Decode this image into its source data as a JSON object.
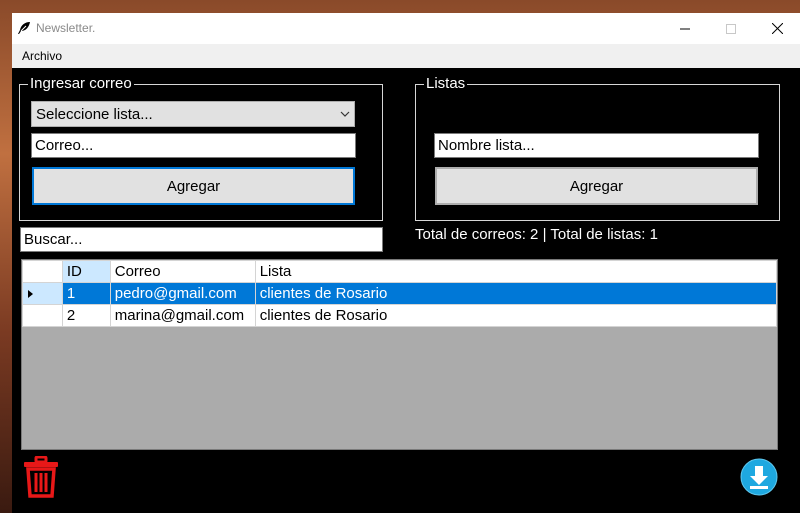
{
  "window": {
    "title": "Newsletter.",
    "icon": "feather-icon"
  },
  "menu": {
    "items": [
      {
        "label": "Archivo"
      }
    ]
  },
  "ingresar": {
    "legend": "Ingresar correo",
    "list_select_value": "Seleccione lista...",
    "email_value": "Correo...",
    "add_label": "Agregar"
  },
  "listas": {
    "legend": "Listas",
    "name_value": "Nombre lista...",
    "add_label": "Agregar"
  },
  "search": {
    "value": "Buscar..."
  },
  "status": {
    "totals": "Total de correos: 2 | Total de listas: 1"
  },
  "grid": {
    "columns": [
      "ID",
      "Correo",
      "Lista"
    ],
    "rows": [
      {
        "id": "1",
        "correo": "pedro@gmail.com",
        "lista": "clientes de Rosario",
        "selected": true
      },
      {
        "id": "2",
        "correo": "marina@gmail.com",
        "lista": "clientes de Rosario",
        "selected": false
      }
    ]
  },
  "actions": {
    "delete_icon": "trash-icon",
    "download_icon": "download-icon"
  },
  "colors": {
    "selection": "#0078d7",
    "form_background": "#000000",
    "trash": "#e81818",
    "download": "#1ea8e0"
  }
}
